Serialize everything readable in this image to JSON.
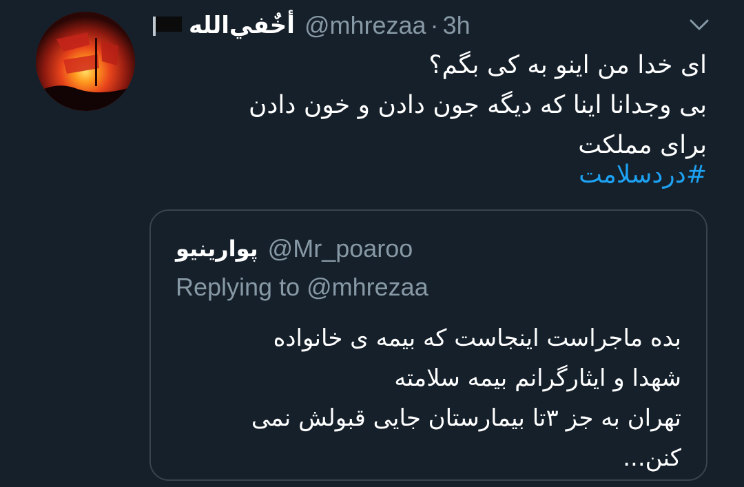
{
  "tweet": {
    "display_name": "أخٌفي‌الله",
    "handle": "@mhrezaa",
    "separator": "·",
    "time": "3h",
    "text_lines": [
      "ای خدا من اینو به کی بگم؟",
      "بی وجدانا اینا که دیگه جون دادن و خون دادن",
      "برای مملکت"
    ],
    "hashtag": "#دردسلامت",
    "icons": {
      "flag": "black-flag-icon",
      "menu": "chevron-down-icon"
    }
  },
  "quote": {
    "display_name": "پوارینیو",
    "handle": "@Mr_poaroo",
    "replying_to": "Replying to @mhrezaa",
    "text_lines": [
      "بده ماجراست اینجاست که بیمه ی خانواده",
      "شهدا و ایثارگرانم بیمه سلامته",
      "تهران به جز ۳تا بیمارستان جایی قبولش نمی",
      "کنن..."
    ]
  },
  "colors": {
    "background": "#15202b",
    "text": "#ffffff",
    "secondary": "#8899a6",
    "link": "#1da1f2",
    "border": "#38444d"
  }
}
